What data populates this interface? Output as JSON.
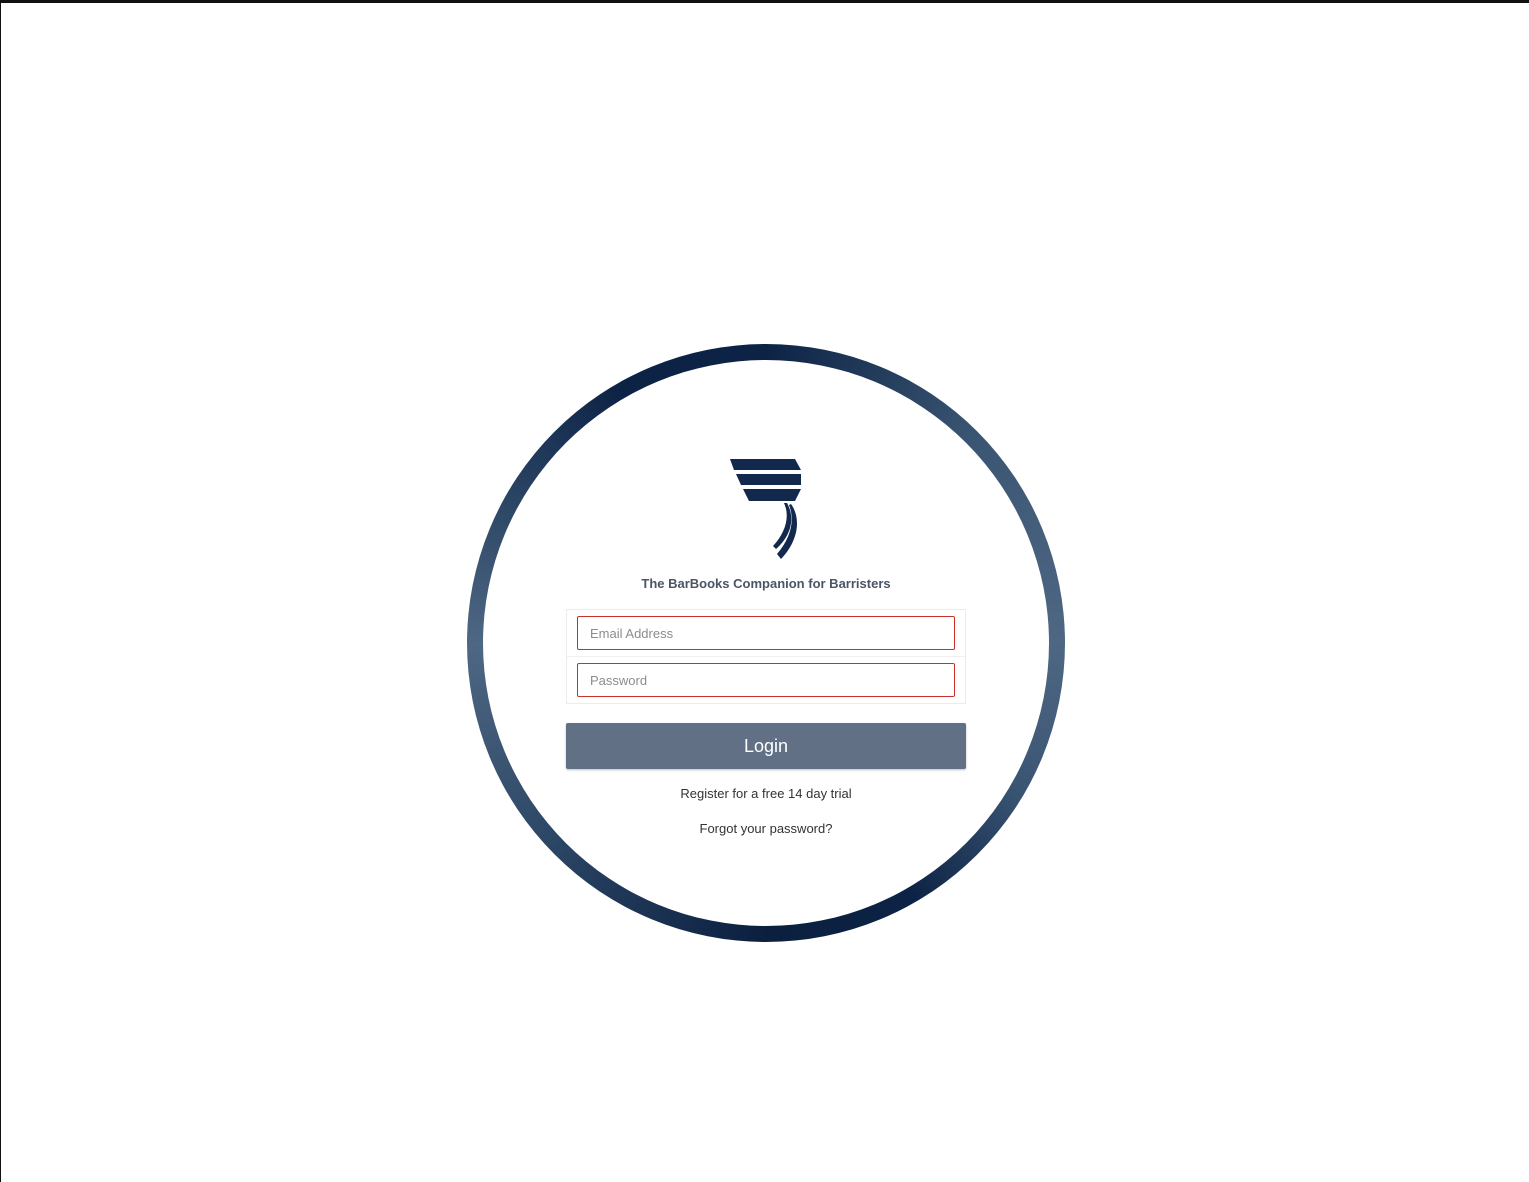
{
  "app": {
    "tagline": "The BarBooks Companion for Barristers",
    "logo_icon": "barbooks-logo-icon",
    "brand_color": "#0d2345"
  },
  "login_form": {
    "email_placeholder": "Email Address",
    "email_value": "",
    "password_placeholder": "Password",
    "password_value": "",
    "field_border_color": "#c9302c",
    "login_label": "Login",
    "login_button_color": "#627086"
  },
  "links": {
    "register": "Register for a free 14 day trial",
    "forgot_password": "Forgot your password?"
  }
}
